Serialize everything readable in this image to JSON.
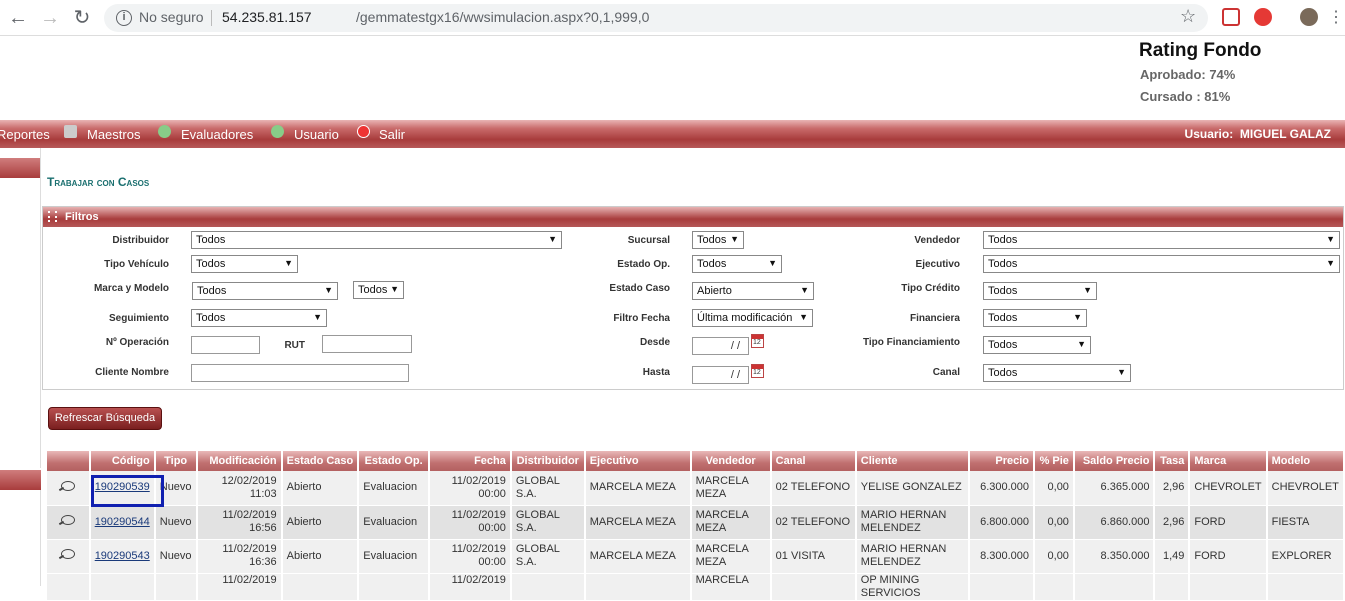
{
  "browser": {
    "security_label": "No seguro",
    "url_host": "54.235.81.157",
    "url_path": "/gemmatestgx16/wwsimulacion.aspx?0,1,999,0"
  },
  "rating": {
    "title": "Rating Fondo",
    "aprobado": "Aprobado: 74%",
    "cursado": "Cursado : 81%"
  },
  "menu": {
    "items": [
      "Reportes",
      "Maestros",
      "Evaluadores",
      "Usuario",
      "Salir"
    ],
    "user_label": "Usuario:",
    "user_name": "MIGUEL GALAZ"
  },
  "page": {
    "title": "Trabajar con Casos",
    "filters_title": "Filtros",
    "refresh_label": "Refrescar Búsqueda"
  },
  "filters": {
    "distribuidor": {
      "label": "Distribuidor",
      "value": "Todos"
    },
    "tipo_vehiculo": {
      "label": "Tipo Vehículo",
      "value": "Todos"
    },
    "marca_modelo": {
      "label": "Marca y Modelo",
      "value": "Todos",
      "value2": "Todos"
    },
    "seguimiento": {
      "label": "Seguimiento",
      "value": "Todos"
    },
    "nro_operacion": {
      "label": "Nº Operación",
      "value": ""
    },
    "rut": {
      "label": "RUT",
      "value": ""
    },
    "cliente_nombre": {
      "label": "Cliente Nombre",
      "value": ""
    },
    "sucursal": {
      "label": "Sucursal",
      "value": "Todos"
    },
    "estado_op": {
      "label": "Estado Op.",
      "value": "Todos"
    },
    "estado_caso": {
      "label": "Estado Caso",
      "value": "Abierto"
    },
    "filtro_fecha": {
      "label": "Filtro Fecha",
      "value": "Última modificación"
    },
    "desde": {
      "label": "Desde",
      "value": "/ /"
    },
    "hasta": {
      "label": "Hasta",
      "value": "/ /"
    },
    "vendedor": {
      "label": "Vendedor",
      "value": "Todos"
    },
    "ejecutivo": {
      "label": "Ejecutivo",
      "value": "Todos"
    },
    "tipo_credito": {
      "label": "Tipo Crédito",
      "value": "Todos"
    },
    "financiera": {
      "label": "Financiera",
      "value": "Todos"
    },
    "tipo_financiamiento": {
      "label": "Tipo Financiamiento",
      "value": "Todos"
    },
    "canal": {
      "label": "Canal",
      "value": "Todos"
    }
  },
  "table": {
    "columns": [
      "Código",
      "Tipo",
      "Modificación",
      "Estado Caso",
      "Estado Op.",
      "Fecha",
      "Distribuidor",
      "Ejecutivo",
      "Vendedor",
      "Canal",
      "Cliente",
      "Precio",
      "% Pie",
      "Saldo Precio",
      "Tasa",
      "Marca",
      "Modelo"
    ],
    "rows": [
      {
        "codigo": "190290539",
        "tipo": "Nuevo",
        "modificacion": "12/02/2019 11:03",
        "estado_caso": "Abierto",
        "estado_op": "Evaluacion",
        "fecha": "11/02/2019 00:00",
        "distribuidor": "GLOBAL S.A.",
        "ejecutivo": "MARCELA MEZA",
        "vendedor": "MARCELA MEZA",
        "canal": "02 TELEFONO",
        "cliente": "YELISE GONZALEZ",
        "precio": "6.300.000",
        "pie": "0,00",
        "saldo": "6.365.000",
        "tasa": "2,96",
        "marca": "CHEVROLET",
        "modelo": "CHEVROLET"
      },
      {
        "codigo": "190290544",
        "tipo": "Nuevo",
        "modificacion": "11/02/2019 16:56",
        "estado_caso": "Abierto",
        "estado_op": "Evaluacion",
        "fecha": "11/02/2019 00:00",
        "distribuidor": "GLOBAL S.A.",
        "ejecutivo": "MARCELA MEZA",
        "vendedor": "MARCELA MEZA",
        "canal": "02 TELEFONO",
        "cliente": "MARIO HERNAN MELENDEZ",
        "precio": "6.800.000",
        "pie": "0,00",
        "saldo": "6.860.000",
        "tasa": "2,96",
        "marca": "FORD",
        "modelo": "FIESTA"
      },
      {
        "codigo": "190290543",
        "tipo": "Nuevo",
        "modificacion": "11/02/2019 16:36",
        "estado_caso": "Abierto",
        "estado_op": "Evaluacion",
        "fecha": "11/02/2019 00:00",
        "distribuidor": "GLOBAL S.A.",
        "ejecutivo": "MARCELA MEZA",
        "vendedor": "MARCELA MEZA",
        "canal": "01 VISITA",
        "cliente": "MARIO HERNAN MELENDEZ",
        "precio": "8.300.000",
        "pie": "0,00",
        "saldo": "8.350.000",
        "tasa": "1,49",
        "marca": "FORD",
        "modelo": "EXPLORER"
      },
      {
        "modificacion": "11/02/2019",
        "fecha": "11/02/2019",
        "vendedor": "MARCELA",
        "cliente": "OP MINING SERVICIOS"
      }
    ]
  }
}
